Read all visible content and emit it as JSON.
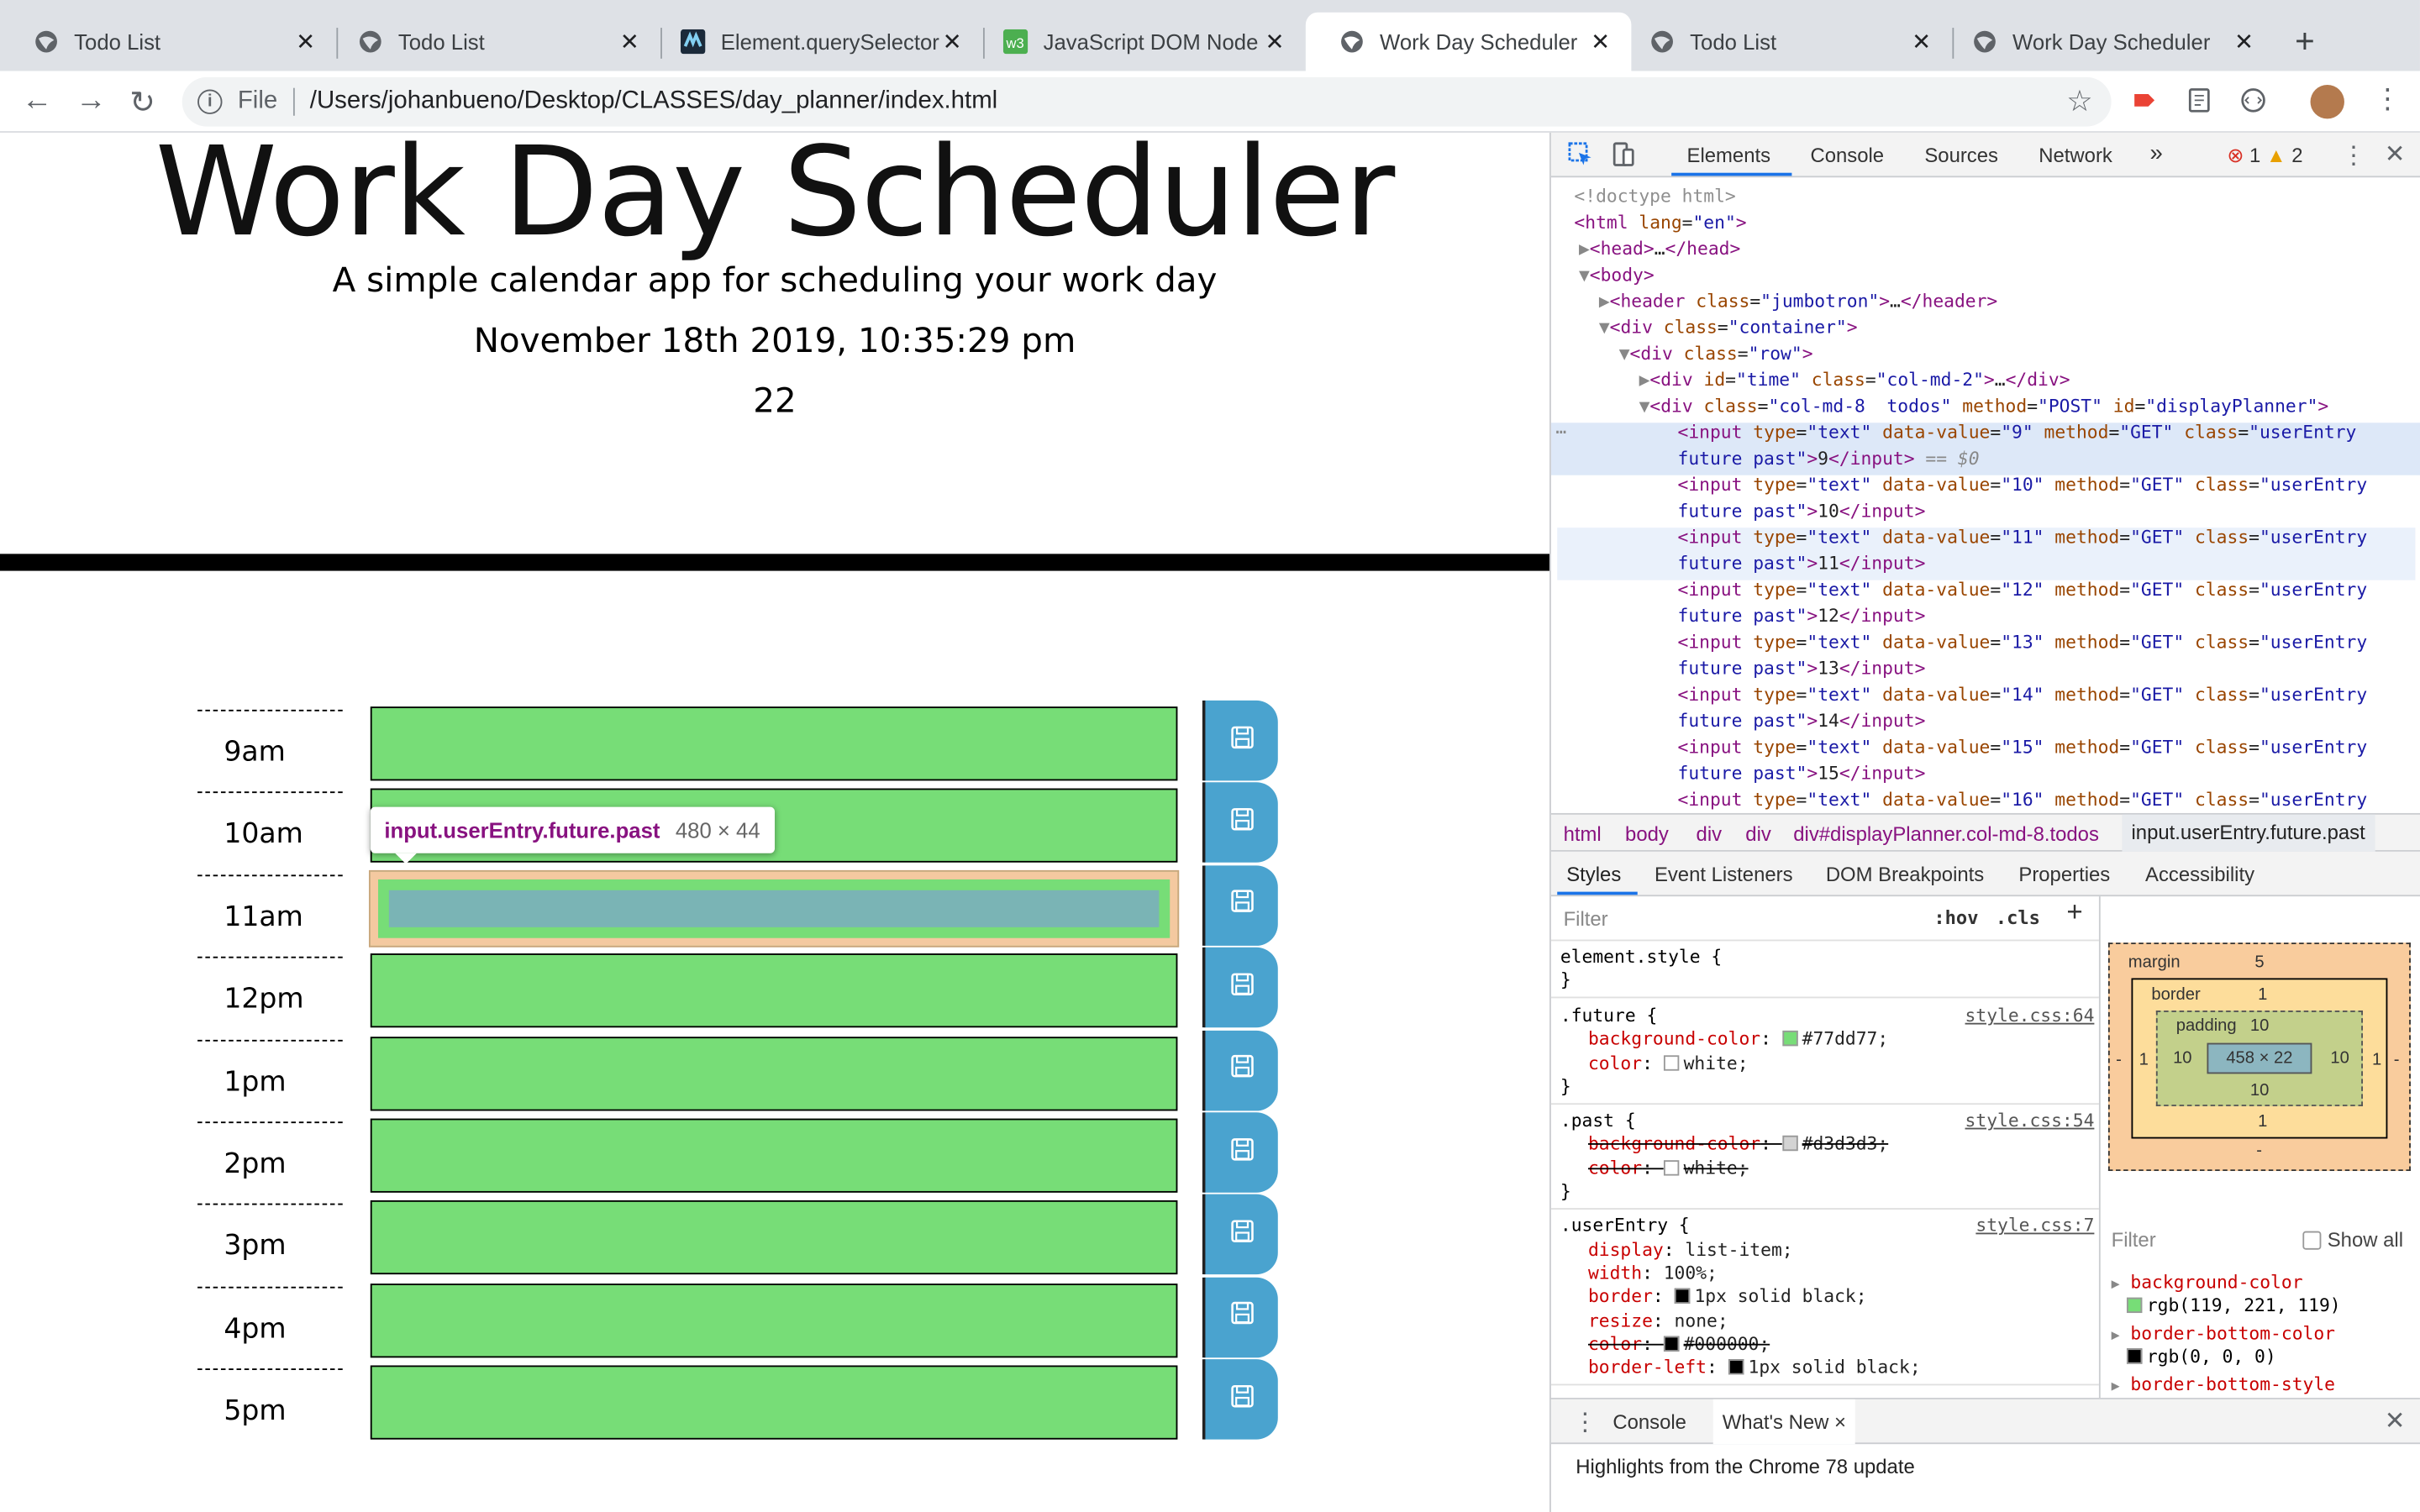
{
  "browser": {
    "tabs": [
      {
        "title": "Todo List",
        "icon": "globe-icon",
        "active": false
      },
      {
        "title": "Todo List",
        "icon": "globe-icon",
        "active": false
      },
      {
        "title": "Element.querySelector",
        "icon": "mdn-icon",
        "active": false
      },
      {
        "title": "JavaScript DOM Node",
        "icon": "w3-icon",
        "active": false
      },
      {
        "title": "Work Day Scheduler",
        "icon": "globe-icon",
        "active": true
      },
      {
        "title": "Todo List",
        "icon": "globe-icon",
        "active": false
      },
      {
        "title": "Work Day Scheduler",
        "icon": "globe-icon",
        "active": false
      }
    ],
    "new_tab": "+",
    "omnibox": {
      "scheme": "File",
      "path": "/Users/johanbueno/Desktop/CLASSES/day_planner/index.html"
    }
  },
  "page": {
    "title": "Work Day Scheduler",
    "lead": "A simple calendar app for scheduling your work day",
    "datetime": "November 18th 2019, 10:35:29 pm",
    "current_hour": "22",
    "hours": [
      "9am",
      "10am",
      "11am",
      "12pm",
      "1pm",
      "2pm",
      "3pm",
      "4pm",
      "5pm"
    ],
    "future_color": "#77dd77",
    "save_color": "#4aa3cf",
    "tooltip": {
      "selector": "input.userEntry.future.past",
      "dims": "480 × 44"
    }
  },
  "devtools": {
    "tabs": [
      "Elements",
      "Console",
      "Sources",
      "Network",
      "»"
    ],
    "errors": "1",
    "warnings": "2",
    "breadcrumbs": [
      "html",
      "body",
      "div",
      "div",
      "div#displayPlanner.col-md-8.todos",
      "input.userEntry.future.past"
    ],
    "subtabs": [
      "Styles",
      "Event Listeners",
      "DOM Breakpoints",
      "Properties",
      "Accessibility"
    ],
    "styles_filter": "Filter",
    "hov": ":hov",
    "cls": ".cls",
    "element_style": "element.style {",
    "rules": [
      {
        "selector": ".future {",
        "source": "style.css:64",
        "decls": [
          {
            "name": "background-color",
            "value": "#77dd77;",
            "swatch": "#77dd77",
            "struck": false
          },
          {
            "name": "color",
            "value": "white;",
            "swatch": "#ffffff",
            "struck": false
          }
        ]
      },
      {
        "selector": ".past {",
        "source": "style.css:54",
        "decls": [
          {
            "name": "background-color",
            "value": "#d3d3d3;",
            "swatch": "#d3d3d3",
            "struck": true
          },
          {
            "name": "color",
            "value": "white;",
            "swatch": "#ffffff",
            "struck": true
          }
        ]
      },
      {
        "selector": ".userEntry {",
        "source": "style.css:7",
        "decls": [
          {
            "name": "display",
            "value": "list-item;",
            "swatch": "",
            "struck": false
          },
          {
            "name": "width",
            "value": "100%;",
            "swatch": "",
            "struck": false
          },
          {
            "name": "border",
            "value": "1px solid  black;",
            "swatch": "#000000",
            "struck": false
          },
          {
            "name": "resize",
            "value": "none;",
            "swatch": "",
            "struck": false
          },
          {
            "name": "color",
            "value": "#000000;",
            "swatch": "#000000",
            "struck": true
          },
          {
            "name": "border-left",
            "value": "1px solid  black;",
            "swatch": "#000000",
            "struck": false
          }
        ]
      }
    ],
    "box_model": {
      "margin": "margin",
      "margin_top": "5",
      "margin_bottom": "-",
      "margin_left": "-",
      "margin_right": "-",
      "border": "border",
      "border_top": "1",
      "border_bottom": "1",
      "border_left": "1",
      "border_right": "1",
      "padding": "padding",
      "padding_top": "10",
      "padding_bottom": "10",
      "padding_left": "10",
      "padding_right": "10",
      "content": "458 × 22"
    },
    "computed_filter": "Filter",
    "show_all": "Show all",
    "computed": [
      {
        "name": "background-color",
        "value": "rgb(119, 221, 119)",
        "swatch": "#77dd77"
      },
      {
        "name": "border-bottom-color",
        "value": "rgb(0, 0, 0)",
        "swatch": "#000000"
      },
      {
        "name": "border-bottom-style",
        "value": "",
        "swatch": ""
      }
    ],
    "drawer": {
      "tabs": [
        "Console",
        "What's New ×"
      ],
      "text": "Highlights from the Chrome 78 update"
    }
  }
}
